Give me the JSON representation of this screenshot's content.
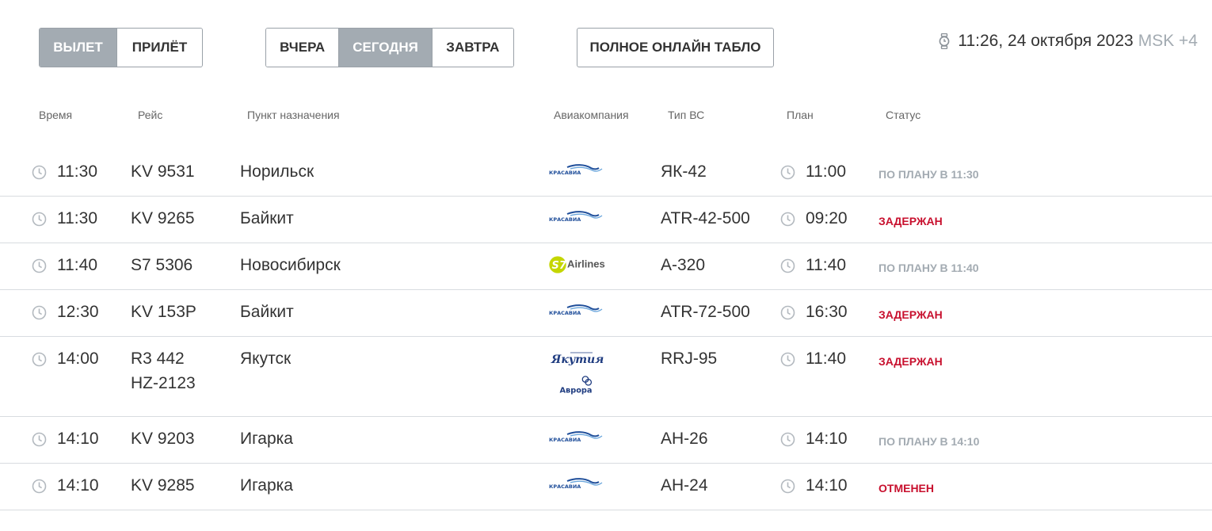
{
  "tabs": {
    "direction": [
      {
        "label": "ВЫЛЕТ",
        "active": true
      },
      {
        "label": "ПРИЛЁТ",
        "active": false
      }
    ],
    "day": [
      {
        "label": "ВЧЕРА",
        "active": false
      },
      {
        "label": "СЕГОДНЯ",
        "active": true
      },
      {
        "label": "ЗАВТРА",
        "active": false
      }
    ],
    "board_button": "ПОЛНОЕ ОНЛАЙН ТАБЛО"
  },
  "clock": {
    "icon": "watch-icon",
    "datetime": "11:26, 24 октября 2023",
    "timezone": "MSK +4"
  },
  "columns": {
    "time": "Время",
    "flight": "Рейс",
    "destination": "Пункт назначения",
    "airline": "Авиакомпания",
    "aircraft": "Тип ВС",
    "plan": "План",
    "status": "Статус"
  },
  "colors": {
    "active_tab": "#a3abb2",
    "status_planned": "#a3abb2",
    "status_delayed": "#c8102e",
    "krasavia_blue": "#1f4e9a",
    "s7_green": "#c4d600"
  },
  "flights": [
    {
      "time": "11:30",
      "flights": [
        "KV 9531"
      ],
      "destination": "Норильск",
      "airlines": [
        {
          "name": "КРАСАВИА",
          "logo": "krasavia-logo"
        }
      ],
      "aircraft": "ЯК-42",
      "plan": "11:00",
      "status": "ПО ПЛАНУ В 11:30",
      "status_type": "planned"
    },
    {
      "time": "11:30",
      "flights": [
        "KV 9265"
      ],
      "destination": "Байкит",
      "airlines": [
        {
          "name": "КРАСАВИА",
          "logo": "krasavia-logo"
        }
      ],
      "aircraft": "ATR-42-500",
      "plan": "09:20",
      "status": "ЗАДЕРЖАН",
      "status_type": "bad"
    },
    {
      "time": "11:40",
      "flights": [
        "S7 5306"
      ],
      "destination": "Новосибирск",
      "airlines": [
        {
          "name": "Airlines",
          "logo": "s7-airlines-logo"
        }
      ],
      "aircraft": "А-320",
      "plan": "11:40",
      "status": "ПО ПЛАНУ В 11:40",
      "status_type": "planned"
    },
    {
      "time": "12:30",
      "flights": [
        "KV 153Р"
      ],
      "destination": "Байкит",
      "airlines": [
        {
          "name": "КРАСАВИА",
          "logo": "krasavia-logo"
        }
      ],
      "aircraft": "ATR-72-500",
      "plan": "16:30",
      "status": "ЗАДЕРЖАН",
      "status_type": "bad"
    },
    {
      "time": "14:00",
      "flights": [
        "R3 442",
        "HZ-2123"
      ],
      "destination": "Якутск",
      "airlines": [
        {
          "name": "Якутия",
          "logo": "yakutia-logo"
        },
        {
          "name": "Аврора",
          "logo": "aurora-logo"
        }
      ],
      "aircraft": "RRJ-95",
      "plan": "11:40",
      "status": "ЗАДЕРЖАН",
      "status_type": "bad"
    },
    {
      "time": "14:10",
      "flights": [
        "KV 9203"
      ],
      "destination": "Игарка",
      "airlines": [
        {
          "name": "КРАСАВИА",
          "logo": "krasavia-logo"
        }
      ],
      "aircraft": "АН-26",
      "plan": "14:10",
      "status": "ПО ПЛАНУ В 14:10",
      "status_type": "planned"
    },
    {
      "time": "14:10",
      "flights": [
        "KV 9285"
      ],
      "destination": "Игарка",
      "airlines": [
        {
          "name": "КРАСАВИА",
          "logo": "krasavia-logo"
        }
      ],
      "aircraft": "АН-24",
      "plan": "14:10",
      "status": "ОТМЕНЕН",
      "status_type": "bad"
    }
  ]
}
